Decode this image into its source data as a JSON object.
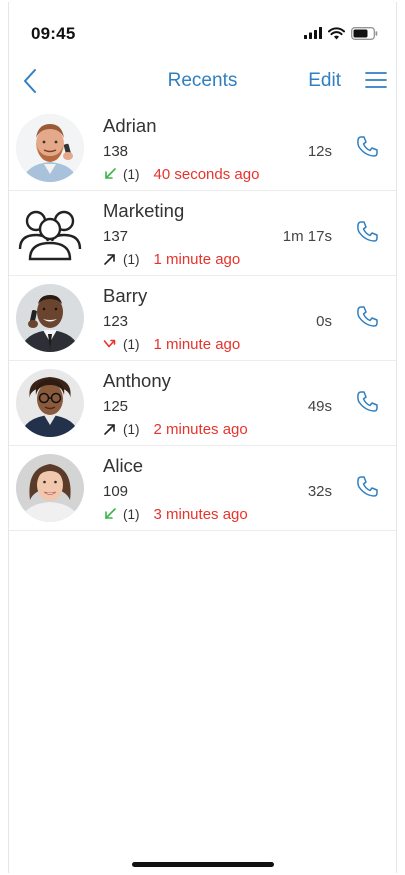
{
  "status_bar": {
    "time": "09:45"
  },
  "nav": {
    "back_icon": "chevron-left-icon",
    "title": "Recents",
    "edit_label": "Edit",
    "menu_icon": "hamburger-menu-icon"
  },
  "colors": {
    "accent": "#2f7fc1",
    "missed_red": "#e8332d",
    "incoming_green": "#3bb54a",
    "outgoing_dark": "#222222"
  },
  "recents": [
    {
      "name": "Adrian",
      "extension": "138",
      "direction": "incoming",
      "count": "(1)",
      "time_ago": "40 seconds ago",
      "duration": "12s",
      "avatar": "photo"
    },
    {
      "name": "Marketing",
      "extension": "137",
      "direction": "outgoing",
      "count": "(1)",
      "time_ago": "1 minute ago",
      "duration": "1m 17s",
      "avatar": "group"
    },
    {
      "name": "Barry",
      "extension": "123",
      "direction": "missed",
      "count": "(1)",
      "time_ago": "1 minute ago",
      "duration": "0s",
      "avatar": "photo"
    },
    {
      "name": "Anthony",
      "extension": "125",
      "direction": "outgoing",
      "count": "(1)",
      "time_ago": "2 minutes ago",
      "duration": "49s",
      "avatar": "photo"
    },
    {
      "name": "Alice",
      "extension": "109",
      "direction": "incoming",
      "count": "(1)",
      "time_ago": "3 minutes ago",
      "duration": "32s",
      "avatar": "photo"
    }
  ]
}
